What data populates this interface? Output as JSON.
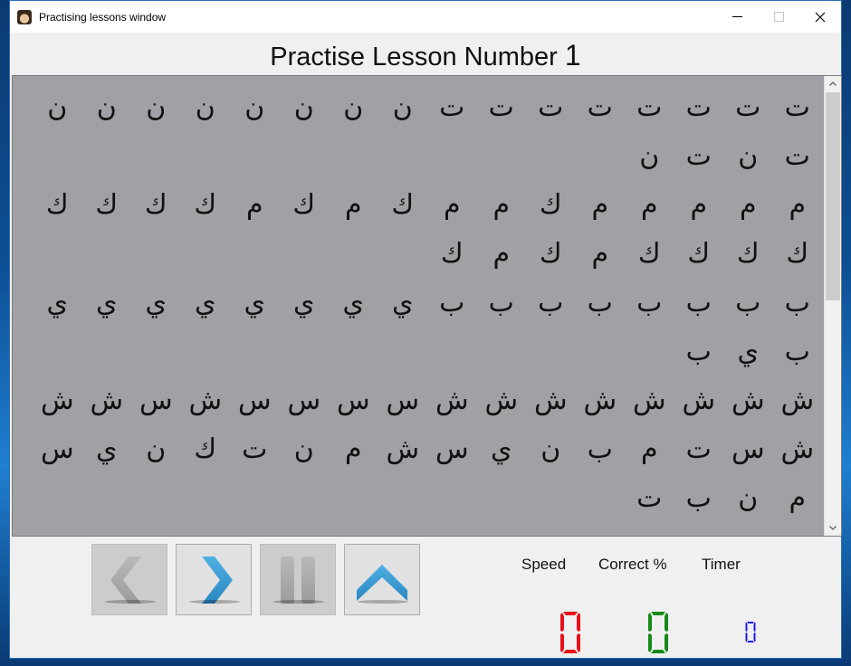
{
  "window": {
    "title": "Practising lessons window",
    "controls": {
      "minimize": "minimize",
      "maximize": "maximize",
      "close": "close"
    }
  },
  "heading": {
    "label": "Practise Lesson Number",
    "lesson_number": "1"
  },
  "lesson": {
    "direction": "rtl",
    "lines": [
      [
        "ت",
        "ت",
        "ت",
        "ت",
        "ت",
        "ت",
        "ت",
        "ت",
        "ن",
        "ن",
        "ن",
        "ن",
        "ن",
        "ن",
        "ن",
        "ن",
        "ت",
        "ن",
        "ت",
        "ن"
      ],
      [
        "م",
        "م",
        "م",
        "م",
        "م",
        "ك",
        "م",
        "م",
        "ك",
        "م",
        "ك",
        "م",
        "ك",
        "ك",
        "ك",
        "ك",
        "ك",
        "ك",
        "ك",
        "ك",
        "م",
        "ك",
        "م",
        "ك"
      ],
      [
        "ب",
        "ب",
        "ب",
        "ب",
        "ب",
        "ب",
        "ب",
        "ب",
        "ي",
        "ي",
        "ي",
        "ي",
        "ي",
        "ي",
        "ي",
        "ي",
        "ب",
        "ي",
        "ب"
      ],
      [
        "ش",
        "ش",
        "ش",
        "ش",
        "ش",
        "ش",
        "ش",
        "ش",
        "س",
        "س",
        "س",
        "س",
        "ش",
        "س",
        "ش",
        "ش"
      ],
      [
        "ش",
        "س",
        "ت",
        "م",
        "ب",
        "ن",
        "ي",
        "س",
        "ش",
        "م",
        "ن",
        "ت",
        "ك",
        "ن",
        "ي",
        "س",
        "م",
        "ن",
        "ب",
        "ت"
      ]
    ]
  },
  "buttons": [
    {
      "name": "previous",
      "icon": "chevron-left-icon",
      "enabled": false
    },
    {
      "name": "next",
      "icon": "chevron-right-icon",
      "enabled": true
    },
    {
      "name": "pause",
      "icon": "pause-icon",
      "enabled": false
    },
    {
      "name": "up",
      "icon": "chevron-up-icon",
      "enabled": true
    }
  ],
  "stats": {
    "speed": {
      "label": "Speed",
      "value": "0",
      "color": "#e8111a"
    },
    "correct": {
      "label": "Correct %",
      "value": "0",
      "color": "#168a16"
    },
    "timer": {
      "label": "Timer",
      "value": "0",
      "color": "#1a1ae6"
    }
  },
  "colors": {
    "accent": "#3a9ad4",
    "lesson_bg": "#a1a0a5",
    "disabled_icon": "#a8a8a8"
  }
}
